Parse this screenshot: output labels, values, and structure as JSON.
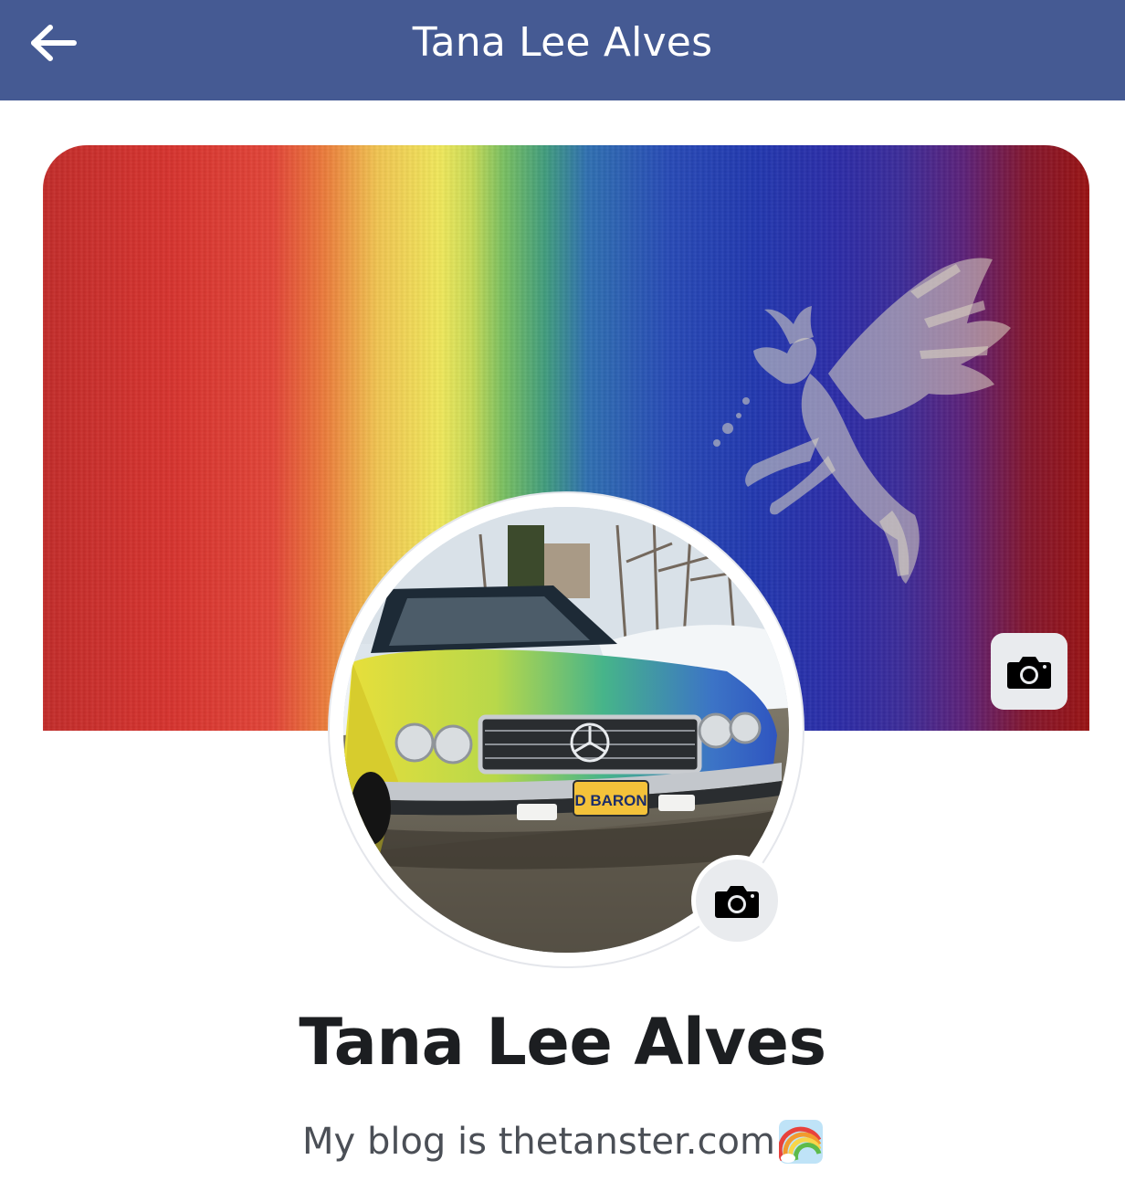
{
  "navbar": {
    "title": "Tana Lee Alves",
    "back_icon": "arrow-left-icon",
    "background_color": "#455a93"
  },
  "cover": {
    "camera_icon": "camera-icon"
  },
  "avatar": {
    "license_plate": "D BARON",
    "camera_icon": "camera-icon"
  },
  "profile": {
    "name": "Tana Lee Alves",
    "bio": "My blog is thetanster.com",
    "bio_emoji": "rainbow-icon"
  }
}
